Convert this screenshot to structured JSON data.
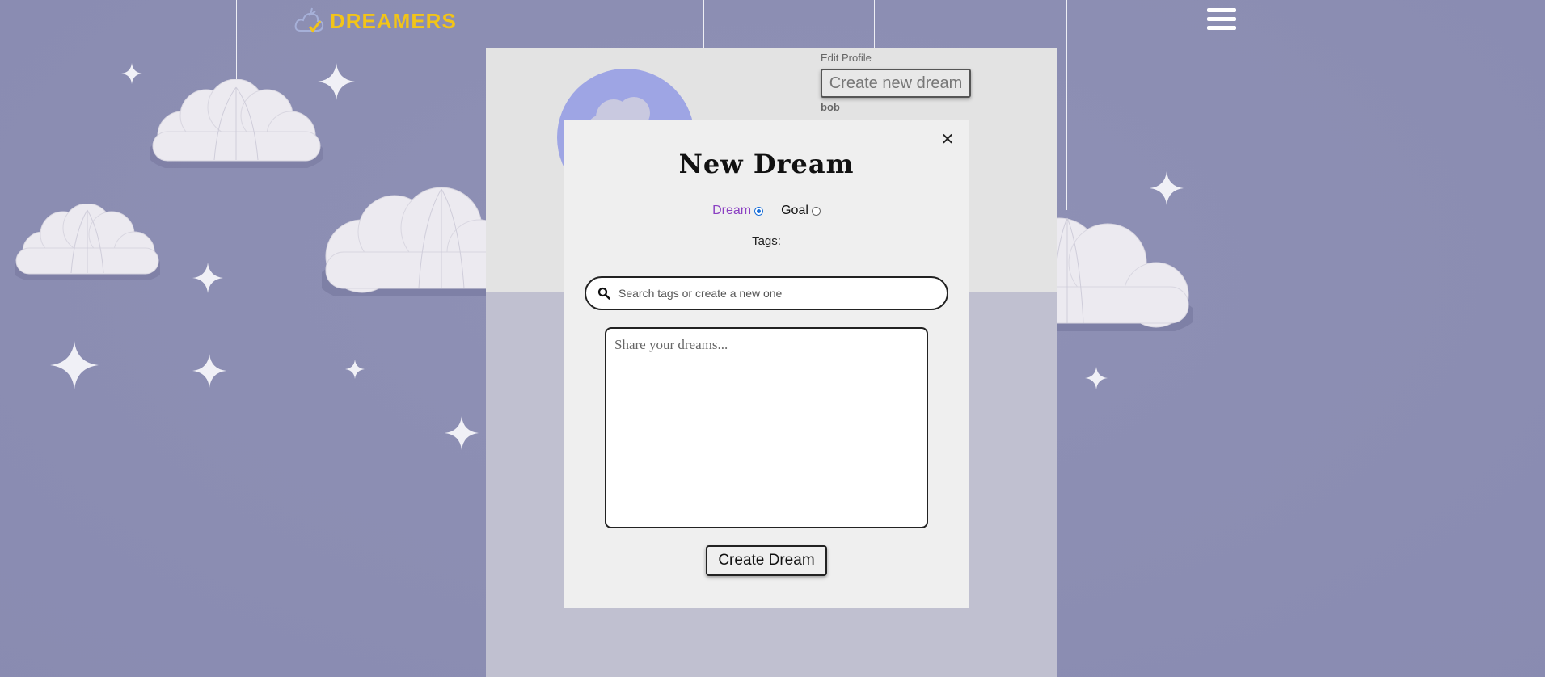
{
  "header": {
    "brand": "DREAMERS",
    "logo_icon": "cloud-check-icon",
    "menu_icon": "hamburger-menu-icon"
  },
  "profile": {
    "edit_label": "Edit Profile",
    "create_button_label": "Create new dream",
    "username": "bob"
  },
  "modal": {
    "title": "New Dream",
    "close_icon": "close-icon",
    "type_options": [
      {
        "label": "Dream",
        "selected": true
      },
      {
        "label": "Goal",
        "selected": false
      }
    ],
    "tags_label": "Tags:",
    "tag_search_placeholder": "Search tags or create a new one",
    "dream_placeholder": "Share your dreams...",
    "submit_label": "Create Dream"
  },
  "colors": {
    "background": "#8f91b5",
    "brand": "#f2c418",
    "dream_label": "#8a3fc2",
    "radio_selected": "#1a6fd8"
  }
}
